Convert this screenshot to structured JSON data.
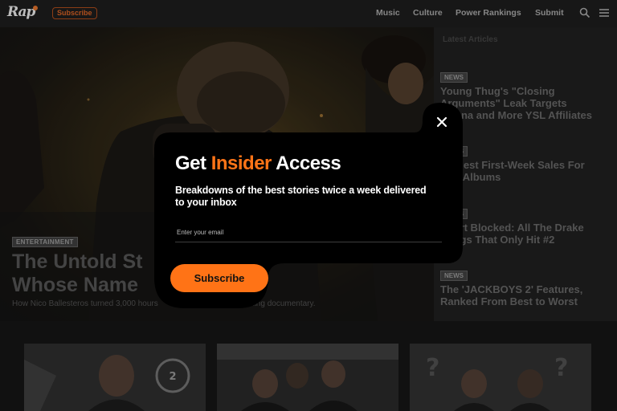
{
  "header": {
    "logo_text": "Rap",
    "subscribe_label": "Subscribe",
    "nav": [
      "Music",
      "Culture",
      "Power Rankings",
      "Submit"
    ],
    "search_icon": "search-icon",
    "menu_icon": "hamburger-menu-icon"
  },
  "hero": {
    "tag": "ENTERTAINMENT",
    "title_line1": "The Untold St",
    "title_line2": "Whose Name",
    "subtitle_left": "How Nico Ballesteros turned 3,000 hours",
    "subtitle_right": "pelling documentary."
  },
  "sidebar": {
    "heading": "Latest Articles",
    "items": [
      {
        "badge": "NEWS",
        "line1": "Young Thug's \"Closing",
        "line2": "Arguments\" Leak Targets",
        "line3": "Gunna and More YSL Affiliates"
      },
      {
        "badge": "NEWS",
        "line1": "Biggest First-Week Sales For",
        "line2": "Rap Albums"
      },
      {
        "badge": "NEWS",
        "line1": "Chart Blocked: All The Drake",
        "line2": "Songs That Only Hit #2"
      },
      {
        "badge": "NEWS",
        "line1": "The 'JACKBOYS 2' Features,",
        "line2": "Ranked From Best to Worst"
      }
    ]
  },
  "modal": {
    "title_part1": "Get ",
    "title_accent": "Insider",
    "title_part2": " Access",
    "description": "Breakdowns of the best stories twice a week delivered to your inbox",
    "email_placeholder": "Enter your email",
    "subscribe_label": "Subscribe",
    "close_icon": "close-icon"
  },
  "colors": {
    "accent": "#ff7417",
    "modal_bg": "#000000",
    "page_bg": "#141414"
  }
}
